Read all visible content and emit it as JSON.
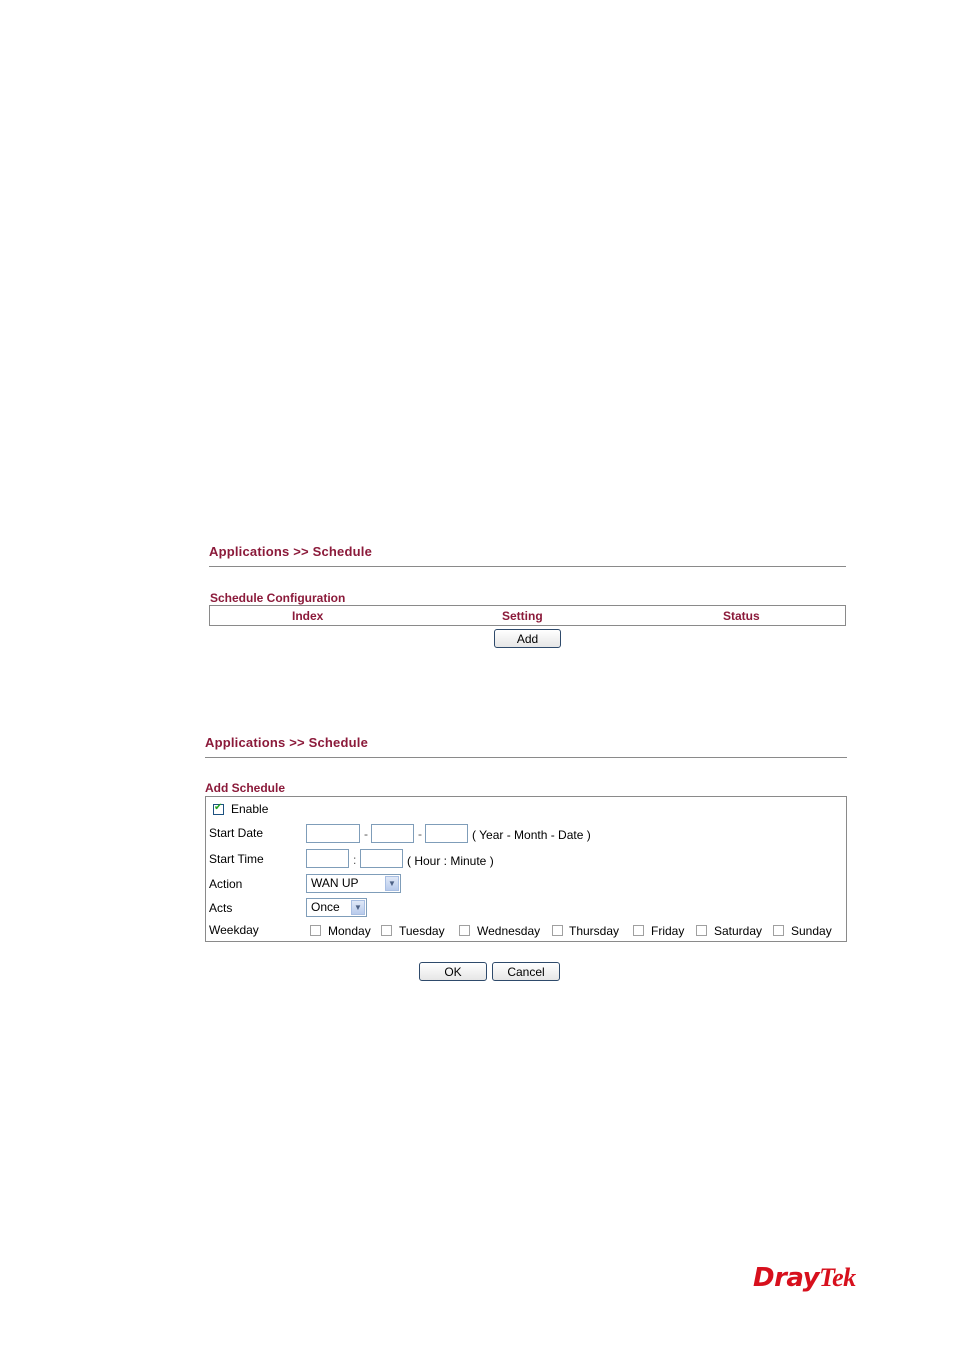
{
  "panel1": {
    "breadcrumb": "Applications >> Schedule",
    "section_title": "Schedule Configuration",
    "table_headers": [
      "Index",
      "Setting",
      "Status"
    ],
    "add_button": "Add"
  },
  "panel2": {
    "breadcrumb": "Applications >> Schedule",
    "section_title": "Add Schedule",
    "enable_label": "Enable",
    "enable_checked": "true",
    "start_date_label": "Start Date",
    "start_date": {
      "year": "",
      "month": "",
      "date": "",
      "sep": "-",
      "hint": "( Year - Month - Date )"
    },
    "start_time_label": "Start Time",
    "start_time": {
      "hour": "",
      "minute": "",
      "sep": ":",
      "hint": "( Hour : Minute )"
    },
    "action_label": "Action",
    "action_value": "WAN UP",
    "acts_label": "Acts",
    "acts_value": "Once",
    "weekday_label": "Weekday",
    "weekdays": [
      "Monday",
      "Tuesday",
      "Wednesday",
      "Thursday",
      "Friday",
      "Saturday",
      "Sunday"
    ],
    "ok_button": "OK",
    "cancel_button": "Cancel"
  },
  "footer": {
    "logo_part1": "Dray",
    "logo_part2": "Tek"
  }
}
